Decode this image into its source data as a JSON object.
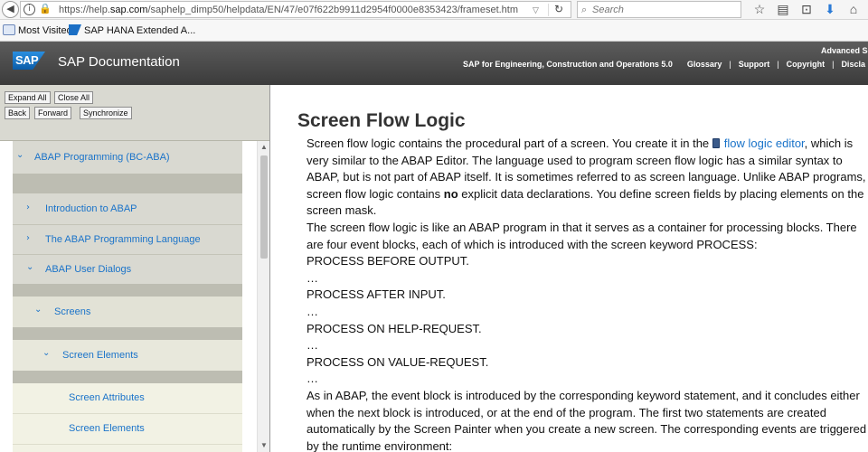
{
  "browser": {
    "url_prefix": "https://help.",
    "url_host": "sap.com",
    "url_path": "/saphelp_dimp50/helpdata/EN/47/e07f622b9911d2954f0000e8353423/frameset.htm",
    "search_placeholder": "Search",
    "bookmarks": [
      {
        "label": "Most Visited",
        "icon": "gear-icon"
      },
      {
        "label": "SAP HANA Extended A...",
        "icon": "sap-bookmark-icon"
      }
    ]
  },
  "sap_header": {
    "logo_text": "SAP",
    "title": "SAP Documentation",
    "advanced_label": "Advanced Se",
    "nav": {
      "product": "SAP for Engineering, Construction and Operations 5.0",
      "glossary": "Glossary",
      "support": "Support",
      "copyright": "Copyright",
      "disclaimer": "Discla",
      "separator": "|"
    }
  },
  "left_panel": {
    "buttons": {
      "expand_all": "Expand All",
      "close_all": "Close All",
      "back": "Back",
      "forward": "Forward",
      "synchronize": "Synchronize"
    },
    "tree": {
      "abap_programming": "ABAP Programming (BC-ABA)",
      "introduction": "Introduction to ABAP",
      "language": "The ABAP Programming Language",
      "user_dialogs": "ABAP User Dialogs",
      "screens": "Screens",
      "screen_elements": "Screen Elements",
      "screen_attributes": "Screen Attributes",
      "screen_elements_leaf": "Screen Elements"
    },
    "expanded_chevron": "⌄",
    "collapsed_chevron": "›"
  },
  "content": {
    "title": "Screen Flow Logic",
    "p1_before_link": "Screen flow logic contains the procedural part of a screen. You create it in the",
    "p1_link": "flow logic editor",
    "p1_after_link": ", which is very similar to the ABAP Editor. The language used to program screen flow logic has a similar syntax to ABAP, but is not part of ABAP itself. It is sometimes referred to as screen language. Unlike ABAP programs, screen flow logic contains",
    "p1_bold": "no",
    "p1_end": "explicit data declarations. You define screen fields by placing elements on the screen mask.",
    "p2": "The screen flow logic is like an ABAP program in that it serves as a container for processing blocks. There are four event blocks, each of which is introduced with the screen keyword PROCESS:",
    "code": {
      "pbo": "PROCESS BEFORE OUTPUT.",
      "pai": "PROCESS AFTER INPUT.",
      "poh": "PROCESS ON HELP-REQUEST.",
      "pov": "PROCESS ON VALUE-REQUEST.",
      "ellipsis": "…"
    },
    "p3": "As in ABAP, the event block is introduced by the corresponding keyword statement, and it concludes either when the next block is introduced, or at the end of the program. The first two statements are created automatically by the Screen Painter when you create a new screen. The corresponding events are triggered by the runtime environment:"
  },
  "colors": {
    "link": "#1a73c9",
    "nav_node_bg": "#d9d9d1",
    "nav_leaf_bg": "#f2f2e4",
    "nav_gap": "#bdbdb2"
  }
}
